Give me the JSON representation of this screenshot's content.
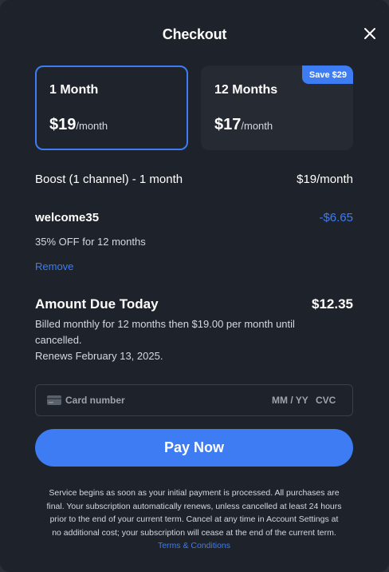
{
  "header": {
    "title": "Checkout"
  },
  "plans": [
    {
      "name": "1 Month",
      "price": "$19",
      "period": "/month",
      "selected": true
    },
    {
      "name": "12 Months",
      "price": "$17",
      "period": "/month",
      "badge": "Save $29",
      "selected": false
    }
  ],
  "line_item": {
    "label": "Boost (1 channel) - 1 month",
    "price": "$19/month"
  },
  "promo": {
    "code": "welcome35",
    "discount": "-$6.65",
    "description": "35% OFF for 12 months",
    "remove_label": "Remove"
  },
  "due": {
    "label": "Amount Due Today",
    "amount": "$12.35",
    "billing_line1": "Billed monthly for 12 months then $19.00 per month until",
    "billing_line2": "cancelled.",
    "renews": "Renews February 13, 2025."
  },
  "card": {
    "number_placeholder": "Card number",
    "expiry_placeholder": "MM / YY",
    "cvc_placeholder": "CVC"
  },
  "pay_button": {
    "label": "Pay Now"
  },
  "legal": {
    "line1": "Service begins as soon as your initial payment is processed. All purchases are",
    "line2": "final. Your subscription automatically renews, unless cancelled at least 24 hours",
    "line3": "prior to the end of your current term. Cancel at any time in Account Settings at",
    "line4": "no additional cost; your subscription will cease at the end of the current term.",
    "terms_link": "Terms & Conditions"
  },
  "colors": {
    "accent": "#3d7cf2",
    "background": "#1e222a",
    "card_bg": "#262b33"
  }
}
